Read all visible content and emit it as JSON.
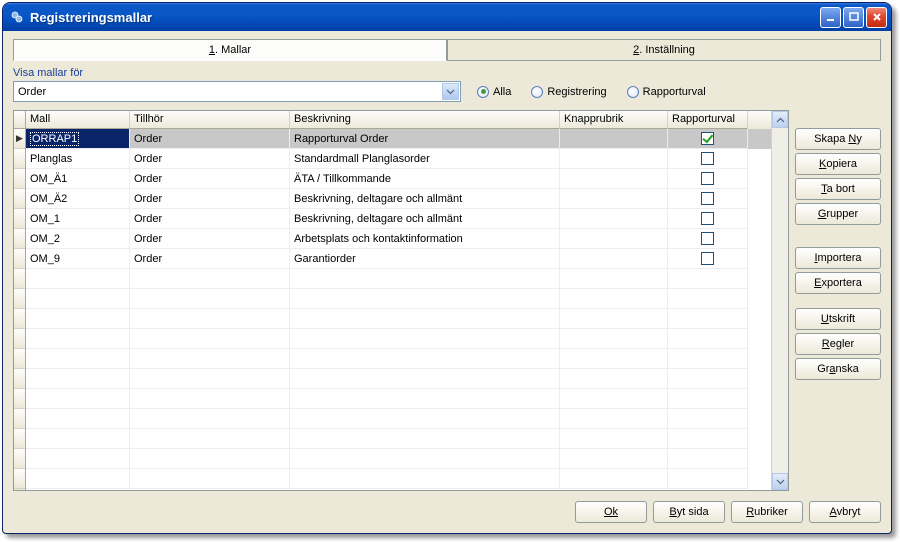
{
  "window": {
    "title": "Registreringsmallar"
  },
  "tabs": [
    {
      "prefix": "1",
      "label": "Mallar",
      "active": true
    },
    {
      "prefix": "2",
      "label": "Inställning",
      "active": false
    }
  ],
  "filter": {
    "label": "Visa mallar för",
    "value": "Order",
    "radios": {
      "all": "Alla",
      "reg": "Registrering",
      "rap": "Rapporturval",
      "selected": "all"
    }
  },
  "grid": {
    "columns": {
      "mall": "Mall",
      "tillhor": "Tillhör",
      "beskr": "Beskrivning",
      "knapp": "Knapprubrik",
      "rapp": "Rapporturval"
    },
    "rows": [
      {
        "mall": "ORRAP1",
        "tillhor": "Order",
        "beskr": "Rapporturval Order",
        "knapp": "",
        "rapp": true,
        "selected": true
      },
      {
        "mall": "Planglas",
        "tillhor": "Order",
        "beskr": "Standardmall Planglasorder",
        "knapp": "",
        "rapp": false,
        "selected": false
      },
      {
        "mall": "OM_Ä1",
        "tillhor": "Order",
        "beskr": "ÄTA / Tillkommande",
        "knapp": "",
        "rapp": false,
        "selected": false
      },
      {
        "mall": "OM_Ä2",
        "tillhor": "Order",
        "beskr": "Beskrivning, deltagare och allmänt",
        "knapp": "",
        "rapp": false,
        "selected": false
      },
      {
        "mall": "OM_1",
        "tillhor": "Order",
        "beskr": "Beskrivning, deltagare och allmänt",
        "knapp": "",
        "rapp": false,
        "selected": false
      },
      {
        "mall": "OM_2",
        "tillhor": "Order",
        "beskr": "Arbetsplats och kontaktinformation",
        "knapp": "",
        "rapp": false,
        "selected": false
      },
      {
        "mall": "OM_9",
        "tillhor": "Order",
        "beskr": "Garantiorder",
        "knapp": "",
        "rapp": false,
        "selected": false
      }
    ]
  },
  "buttons": {
    "skapany": "Skapa Ny",
    "kopiera": "Kopiera",
    "tabort": "Ta bort",
    "grupper": "Grupper",
    "importera": "Importera",
    "exportera": "Exportera",
    "utskrift": "Utskrift",
    "regler": "Regler",
    "granska": "Granska"
  },
  "footer": {
    "ok": "Ok",
    "bytsida": "Byt sida",
    "rubriker": "Rubriker",
    "avbryt": "Avbryt"
  }
}
